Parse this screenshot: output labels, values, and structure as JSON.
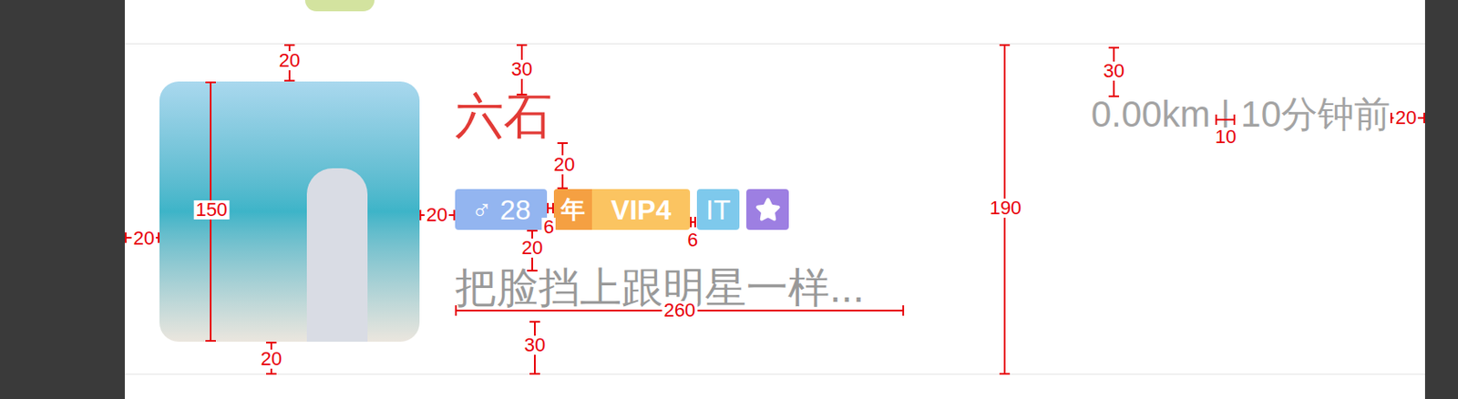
{
  "item": {
    "name": "六石",
    "tags": [
      {
        "kind": "gender",
        "text": "♂ 28",
        "color": "#93b5f0"
      },
      {
        "kind": "vip",
        "badge": "年",
        "text": "VIP4",
        "color": "#fbc461"
      },
      {
        "kind": "text",
        "text": "IT",
        "color": "#7ec9ec"
      },
      {
        "kind": "icon",
        "color": "#9d7fe2"
      }
    ],
    "description": "把脸挡上跟明星一样...",
    "distance": "0.00km",
    "separator": "|",
    "time": "10分钟前"
  },
  "annotations": [
    {
      "label": "20",
      "kind": "vertical"
    },
    {
      "label": "30",
      "kind": "vertical"
    },
    {
      "label": "30",
      "kind": "vertical"
    },
    {
      "label": "150",
      "kind": "vertical"
    },
    {
      "label": "20",
      "kind": "horizontal"
    },
    {
      "label": "20",
      "kind": "horizontal"
    },
    {
      "label": "20",
      "kind": "vertical"
    },
    {
      "label": "6",
      "kind": "horizontal"
    },
    {
      "label": "20",
      "kind": "vertical"
    },
    {
      "label": "6",
      "kind": "horizontal"
    },
    {
      "label": "260",
      "kind": "horizontal"
    },
    {
      "label": "30",
      "kind": "vertical"
    },
    {
      "label": "20",
      "kind": "vertical"
    },
    {
      "label": "190",
      "kind": "vertical"
    },
    {
      "label": "10",
      "kind": "horizontal"
    },
    {
      "label": "20",
      "kind": "horizontal"
    }
  ]
}
